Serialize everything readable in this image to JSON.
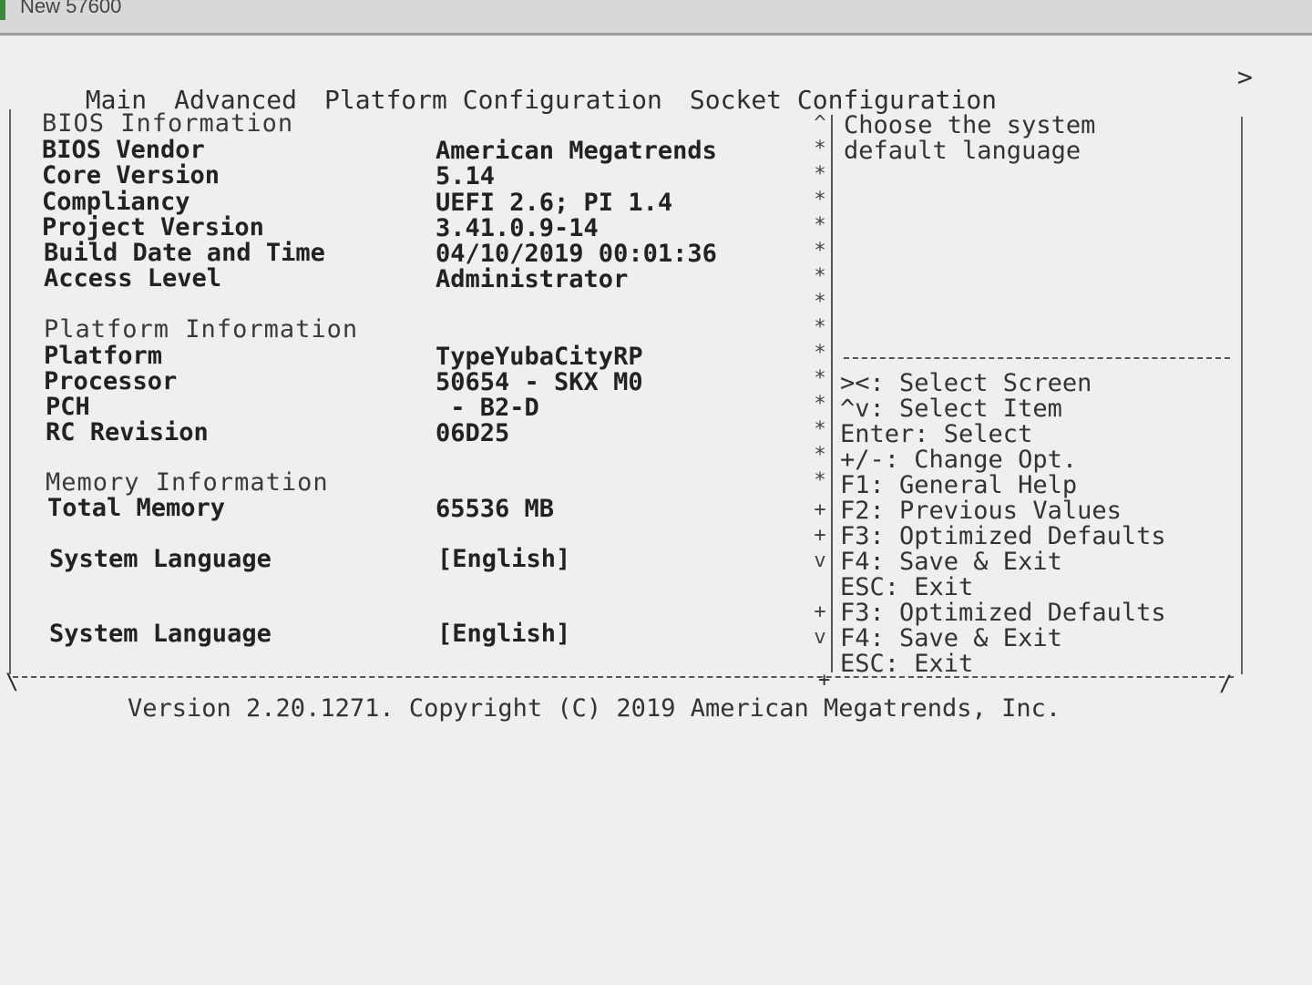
{
  "window": {
    "title": "New 57600"
  },
  "tabs": [
    "Main",
    "Advanced",
    "Platform Configuration",
    "Socket Configuration"
  ],
  "tab_scroll_glyph": ">",
  "bios_info": {
    "header": "BIOS Information",
    "rows": [
      {
        "label": "BIOS Vendor",
        "value": "American Megatrends"
      },
      {
        "label": "Core Version",
        "value": "5.14"
      },
      {
        "label": "Compliancy",
        "value": "UEFI 2.6; PI 1.4"
      },
      {
        "label": "Project Version",
        "value": "3.41.0.9-14"
      },
      {
        "label": "Build Date and Time",
        "value": "04/10/2019 00:01:36"
      },
      {
        "label": "Access Level",
        "value": "Administrator"
      }
    ]
  },
  "platform_info": {
    "header": "Platform Information",
    "rows": [
      {
        "label": "Platform",
        "value": "TypeYubaCityRP"
      },
      {
        "label": "Processor",
        "value": "50654 - SKX M0"
      },
      {
        "label": "PCH",
        "value": " - B2-D"
      },
      {
        "label": "RC Revision",
        "value": "06D25"
      }
    ]
  },
  "memory_info": {
    "header": "Memory Information",
    "rows": [
      {
        "label": "Total Memory",
        "value": "65536 MB"
      }
    ]
  },
  "language_rows": [
    {
      "label": "System Language",
      "value": "[English]"
    },
    {
      "label": "System Language",
      "value": "[English]"
    }
  ],
  "scroll_glyphs": [
    "^",
    "*",
    "*",
    "*",
    "*",
    "*",
    "*",
    "*",
    "*",
    "*",
    "*",
    "*",
    "*",
    "*",
    "*",
    "+",
    "+",
    "v",
    "",
    "+",
    "v"
  ],
  "help": {
    "description": [
      "Choose the system",
      "default language"
    ],
    "keys": [
      "><: Select Screen",
      "^v: Select Item",
      "Enter: Select",
      "+/-: Change Opt.",
      "F1: General Help",
      "F2: Previous Values",
      "F3: Optimized Defaults",
      "F4: Save & Exit",
      "ESC: Exit",
      "F3: Optimized Defaults",
      "F4: Save & Exit",
      "ESC: Exit"
    ]
  },
  "footer": {
    "version": "Version 2.20.1271. Copyright (C) 2019 American Megatrends, Inc."
  }
}
